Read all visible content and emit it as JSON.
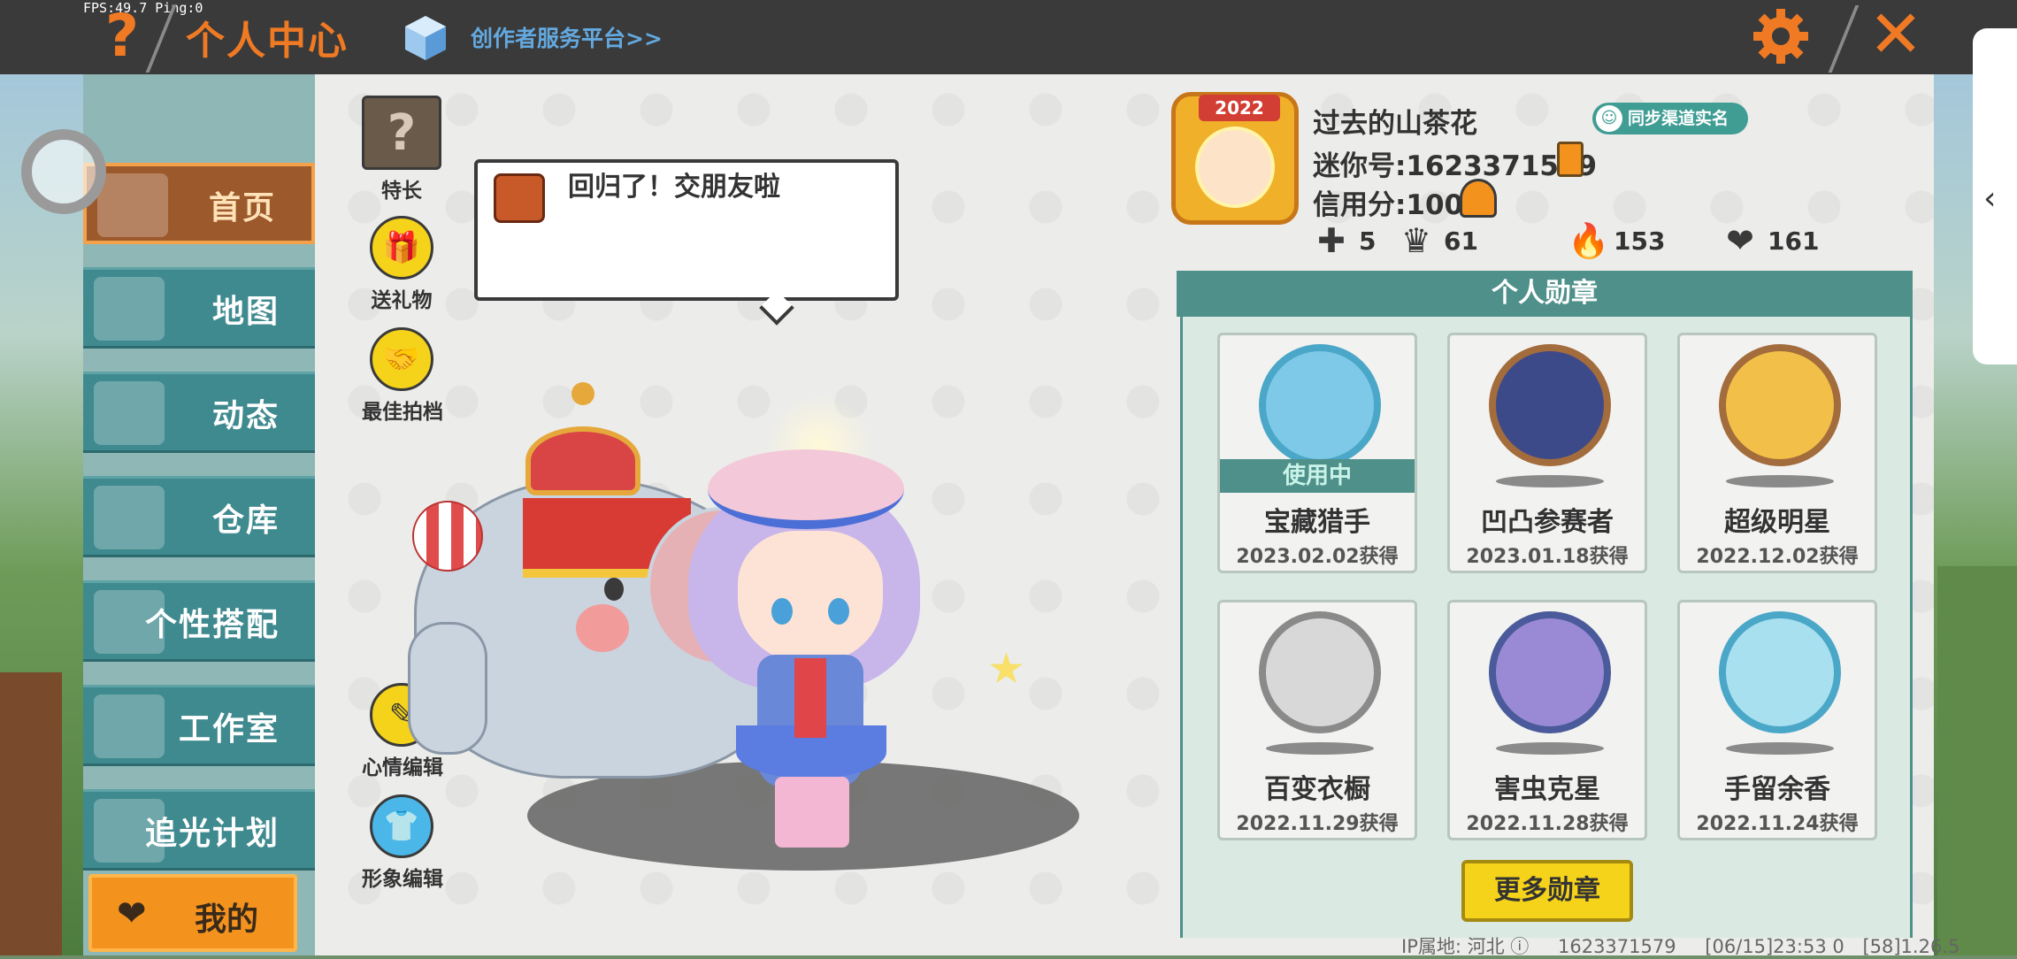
{
  "status": {
    "fps": "FPS:49.7  Ping:0"
  },
  "header": {
    "title": "个人中心",
    "creator_link": "创作者服务平台>>",
    "help_glyph": "?",
    "close_glyph": "✕"
  },
  "nav": {
    "items": [
      {
        "label": "首页",
        "active": true
      },
      {
        "label": "地图",
        "active": false
      },
      {
        "label": "动态",
        "active": false
      },
      {
        "label": "仓库",
        "active": false
      },
      {
        "label": "个性搭配",
        "active": false
      },
      {
        "label": "工作室",
        "active": false
      },
      {
        "label": "追光计划",
        "active": false
      }
    ],
    "my_label": "我的"
  },
  "side_actions": {
    "specialty": "特长",
    "gift": "送礼物",
    "best_photo": "最佳拍档",
    "mood_edit": "心情编辑",
    "image_edit": "形象编辑"
  },
  "bubble": {
    "text": "回归了！交朋友啦"
  },
  "profile": {
    "avatar_badge": "2022",
    "name": "过去的山茶花",
    "mini_id": "迷你号:1623371579",
    "credit": "信用分:100",
    "sync_badge": "同步渠道实名",
    "stats": {
      "friends": "5",
      "fans": "61",
      "popularity": "153",
      "likes": "161"
    }
  },
  "medals": {
    "header": "个人勋章",
    "in_use_label": "使用中",
    "items": [
      {
        "name": "宝藏猎手",
        "date": "2023.02.02获得",
        "in_use": true
      },
      {
        "name": "凹凸参赛者",
        "date": "2023.01.18获得",
        "in_use": false
      },
      {
        "name": "超级明星",
        "date": "2022.12.02获得",
        "in_use": false
      },
      {
        "name": "百变衣橱",
        "date": "2022.11.29获得",
        "in_use": false
      },
      {
        "name": "害虫克星",
        "date": "2022.11.28获得",
        "in_use": false
      },
      {
        "name": "手留余香",
        "date": "2022.11.24获得",
        "in_use": false
      }
    ],
    "more_button": "更多勋章"
  },
  "footer": {
    "ip_location": "IP属地: 河北",
    "uid": "1623371579",
    "timestamp": "[06/15]23:53 0",
    "version": "[58]1.26.5"
  },
  "colors": {
    "accent_orange": "#f07a24",
    "teal": "#4f908a",
    "nav_teal": "#3f8a8f",
    "yellow": "#f5d31a"
  }
}
